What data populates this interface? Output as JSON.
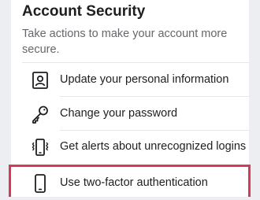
{
  "section": {
    "title": "Account Security",
    "description": "Take actions to make your account more secure."
  },
  "items": [
    {
      "label": "Update your personal information",
      "icon": "id-card-icon"
    },
    {
      "label": "Change your password",
      "icon": "key-icon"
    },
    {
      "label": "Get alerts about unrecognized logins",
      "icon": "phone-alert-icon"
    },
    {
      "label": "Use two-factor authentication",
      "icon": "phone-icon"
    }
  ],
  "colors": {
    "highlight": "#d63a55",
    "text": "#1c1e21",
    "muted": "#65676b"
  }
}
